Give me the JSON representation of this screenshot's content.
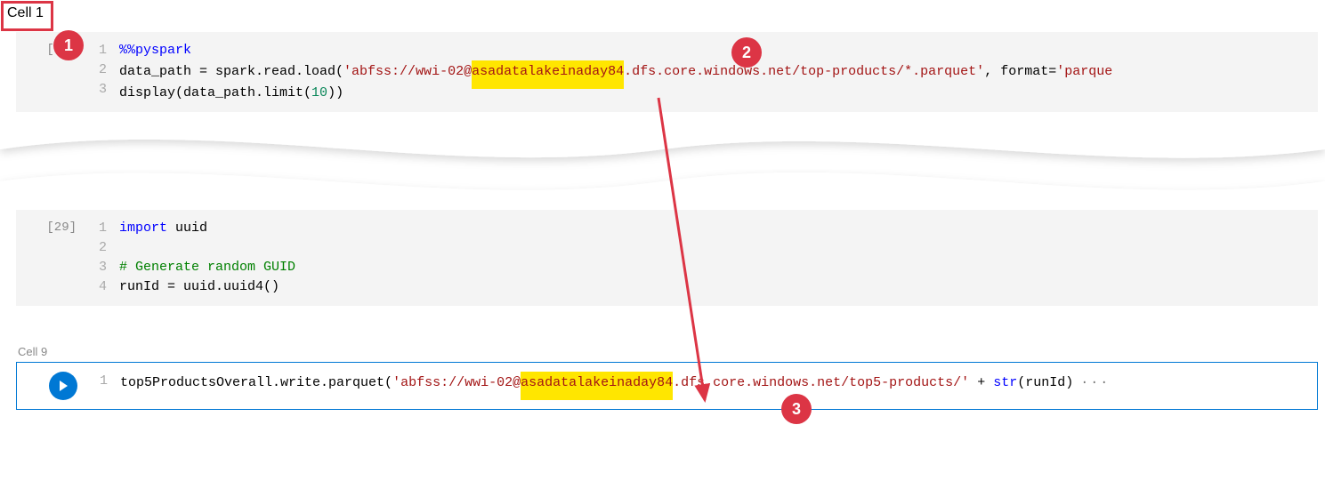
{
  "cells": {
    "cell1": {
      "label": "Cell 1",
      "exec": "[22]",
      "lines": {
        "l1": {
          "n": "1",
          "magic": "%%pyspark"
        },
        "l2": {
          "n": "2",
          "pre": "data_path = spark.read.load(",
          "str1": "'abfss://wwi-02@",
          "hl": "asadatalakeinaday84",
          "str2": ".dfs.core.windows.net/top-products/*.parquet'",
          "mid": ", format=",
          "str3": "'parque"
        },
        "l3": {
          "n": "3",
          "pre": "display(data_path.limit(",
          "num": "10",
          "post": "))"
        }
      }
    },
    "cell_mid": {
      "exec": "[29]",
      "lines": {
        "l1": {
          "n": "1",
          "kw": "import",
          "rest": " uuid"
        },
        "l2": {
          "n": "2"
        },
        "l3": {
          "n": "3",
          "comment": "# Generate random GUID"
        },
        "l4": {
          "n": "4",
          "code": "runId = uuid.uuid4()"
        }
      }
    },
    "cell9": {
      "label": "Cell 9",
      "lines": {
        "l1": {
          "n": "1",
          "pre": "top5ProductsOverall.write.parquet(",
          "str1": "'abfss://wwi-02@",
          "hl": "asadatalakeinaday84",
          "str2": ".dfs.core.windows.net/top5-products/'",
          "mid": " + ",
          "call": "str",
          "post": "(runId)",
          "ellipsis": "···"
        }
      }
    }
  },
  "callouts": {
    "c1": "1",
    "c2": "2",
    "c3": "3"
  }
}
